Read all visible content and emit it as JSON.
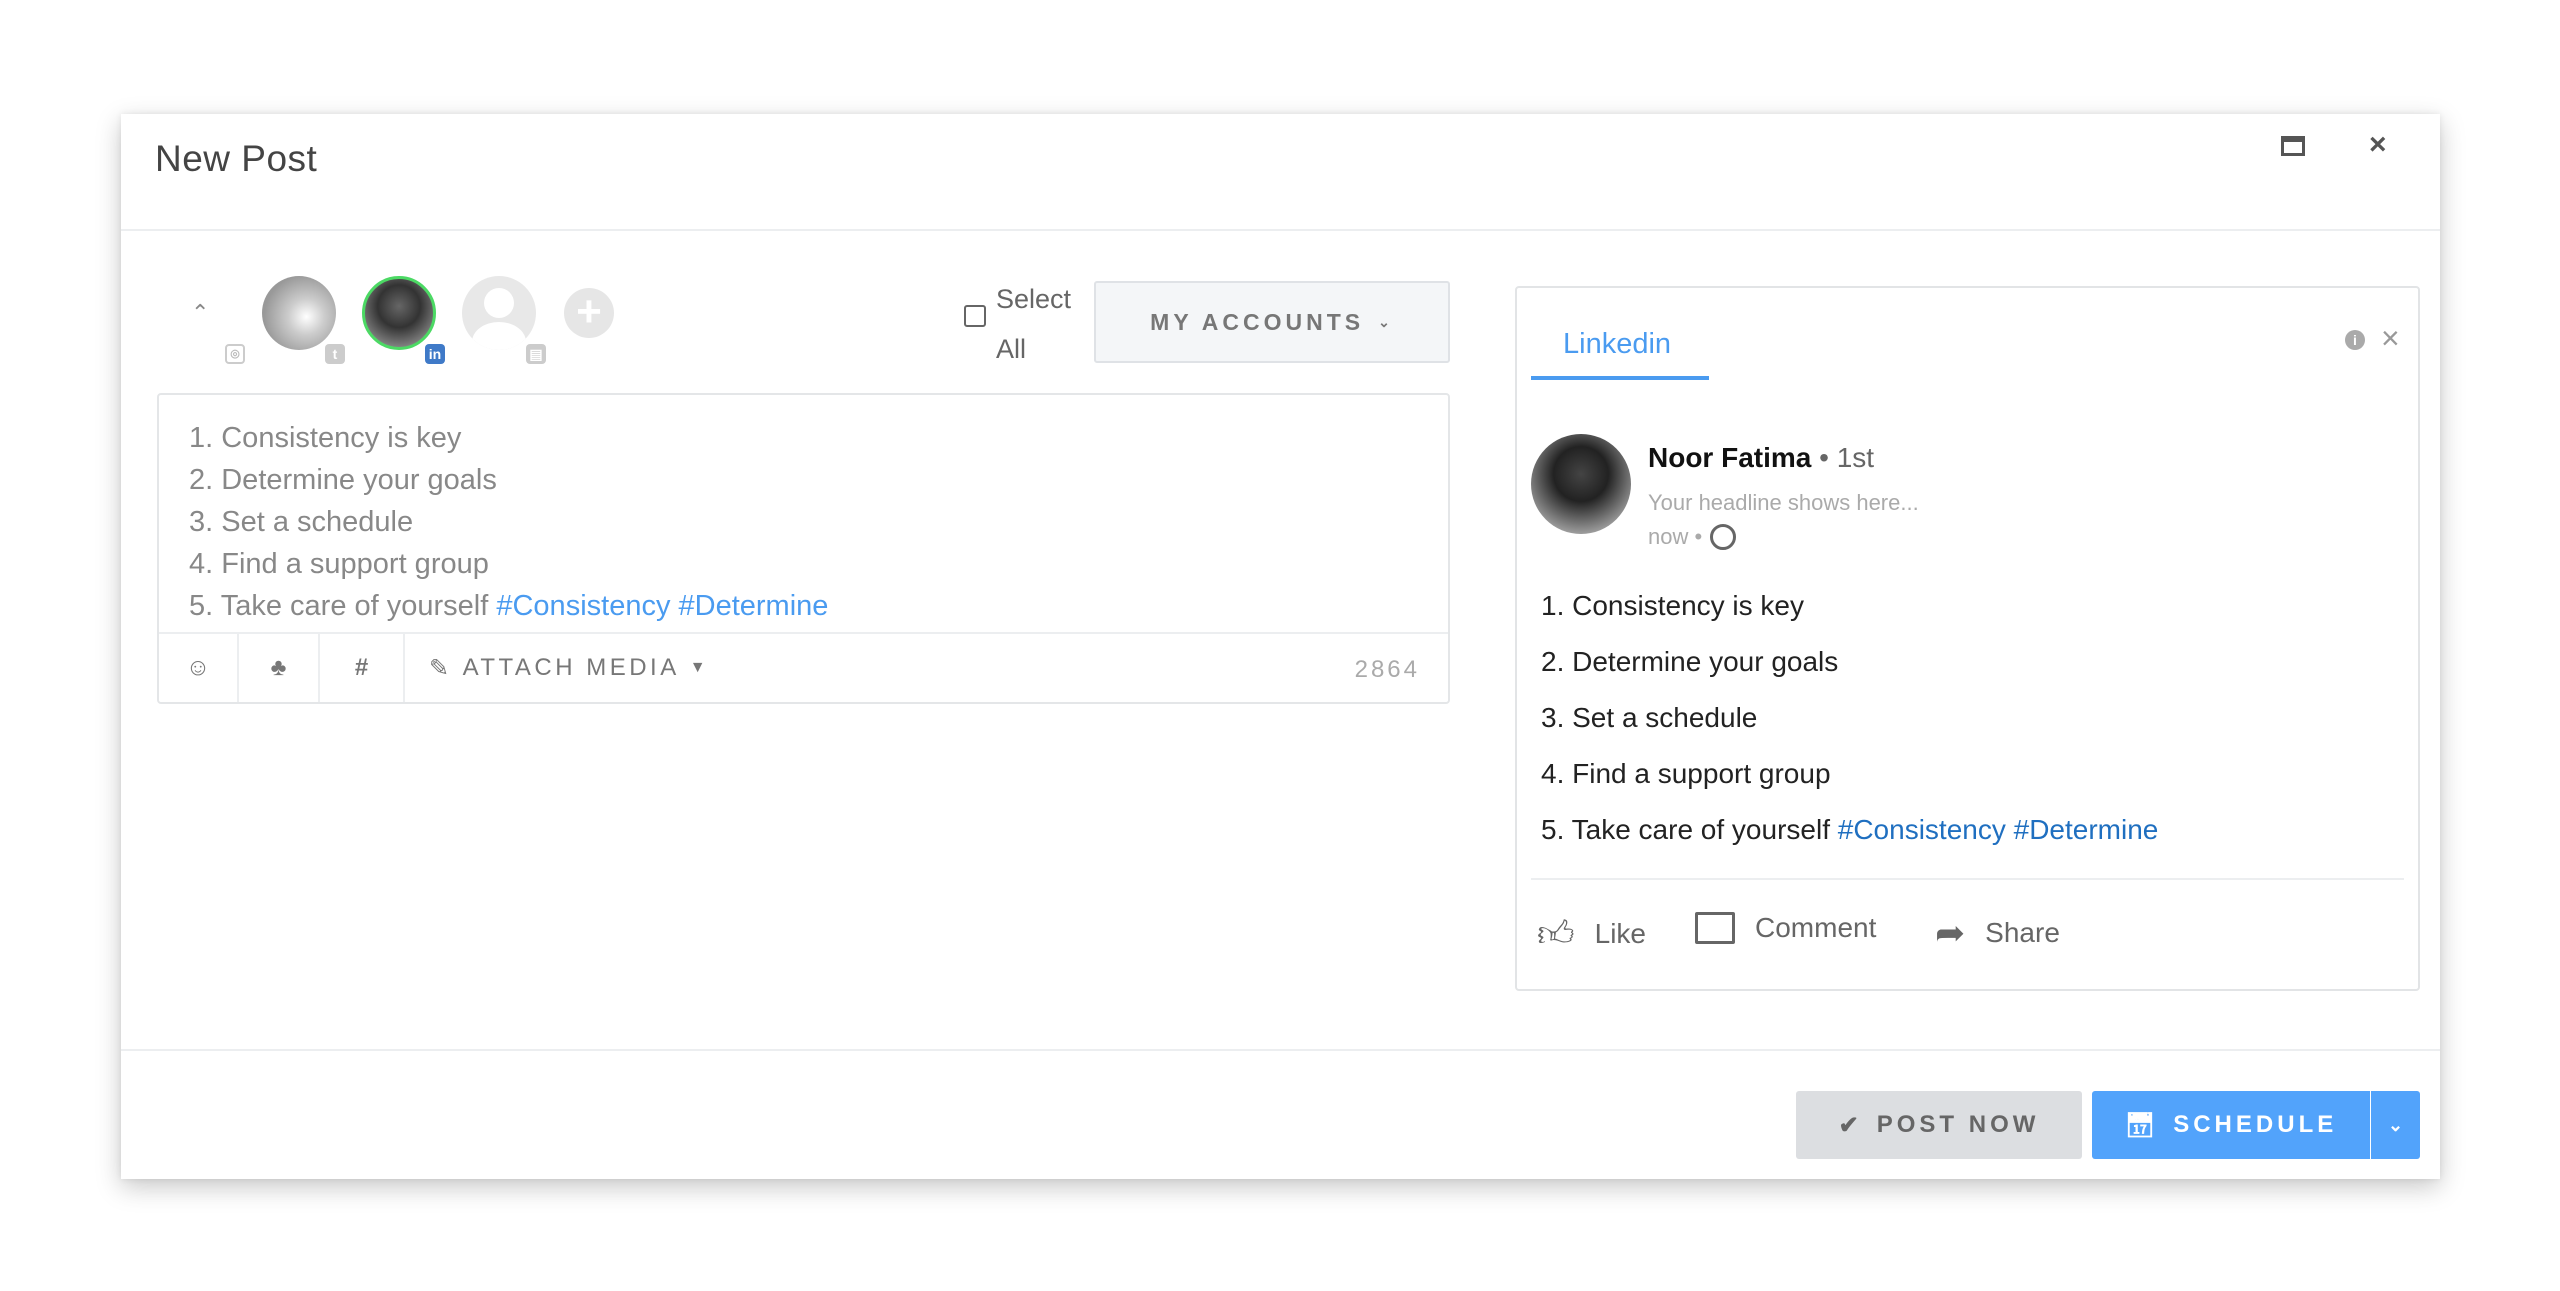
{
  "header": {
    "title": "New Post",
    "maximize_icon": "window-maximize-icon",
    "close_icon": "close-icon"
  },
  "accounts": {
    "items": [
      {
        "name": "instagram-account",
        "network": "instagram"
      },
      {
        "name": "twitter-account",
        "network": "twitter"
      },
      {
        "name": "linkedin-account",
        "network": "linkedin",
        "selected": true
      },
      {
        "name": "other-account",
        "network": "business"
      }
    ],
    "select_all_line1": "Select",
    "select_all_line2": "All",
    "my_accounts": "MY ACCOUNTS",
    "selected_color": "#4cd964"
  },
  "editor": {
    "lines": [
      "1. Consistency is key",
      "2. Determine your goals",
      "3. Set a schedule",
      "4. Find a support group",
      "5. Take care of yourself "
    ],
    "hashtags": [
      "#Consistency",
      "#Determine"
    ],
    "attach_media": "ATTACH MEDIA",
    "char_count": "2864"
  },
  "preview": {
    "tab": "Linkedin",
    "name": "Noor Fatima",
    "degree": " • 1st",
    "headline": "Your headline shows here...",
    "time": "now •",
    "lines": [
      "1. Consistency is key",
      "2. Determine your goals",
      "3. Set a schedule",
      "4. Find a support group",
      "5. Take care of yourself "
    ],
    "hashtags": [
      "#Consistency",
      "#Determine"
    ],
    "actions": {
      "like": "Like",
      "comment": "Comment",
      "share": "Share"
    }
  },
  "footer": {
    "post_now": "POST NOW",
    "schedule": "SCHEDULE",
    "accent": "#52a3fb"
  }
}
